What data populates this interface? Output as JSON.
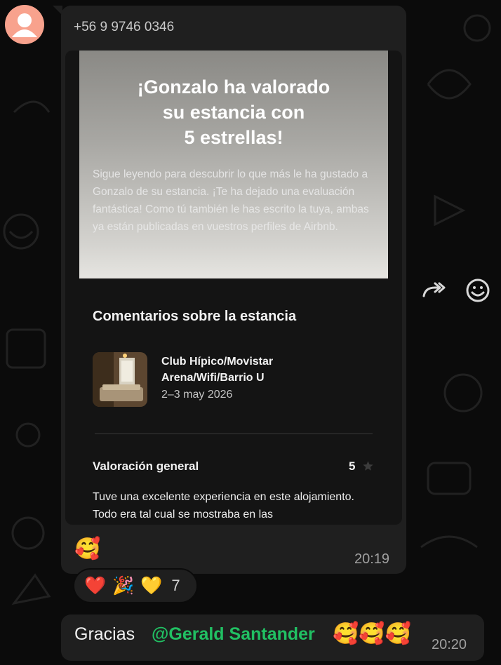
{
  "chat": {
    "sender_phone": "+56 9 9746 0346",
    "card": {
      "hero_title": "¡Gonzalo ha valorado\nsu estancia con\n5 estrellas!",
      "hero_body": "Sigue leyendo para descubrir lo que más le ha gustado a Gonzalo de su estancia. ¡Te ha dejado una evaluación fantástica! Como tú también le has escrito la tuya, ambas ya están publicadas en vuestros perfiles de Airbnb.",
      "section_title": "Comentarios sobre la estancia",
      "listing_name": "Club Hípico/Movistar Arena/Wifi/Barrio U",
      "listing_dates": "2–3 may 2026",
      "rating_label": "Valoración general",
      "rating_value": "5",
      "review_text": "Tuve una excelente experiencia en este alojamiento. Todo era tal cual se mostraba en las"
    },
    "incoming_emoji": "🥰",
    "incoming_time": "20:19",
    "reactions": {
      "emojis": [
        "❤️",
        "🎉",
        "💛"
      ],
      "count": "7"
    },
    "outgoing": {
      "text": "Gracias",
      "mention": "@Gerald Santander",
      "emojis": "🥰🥰🥰",
      "time": "20:20"
    }
  },
  "colors": {
    "background": "#0b0b0b",
    "bubble": "#1f1f1f",
    "mention": "#21c063",
    "avatar": "#f8a28d"
  },
  "icons": [
    "person-icon",
    "forward-icon",
    "emoji-smiley-icon",
    "star-icon"
  ]
}
